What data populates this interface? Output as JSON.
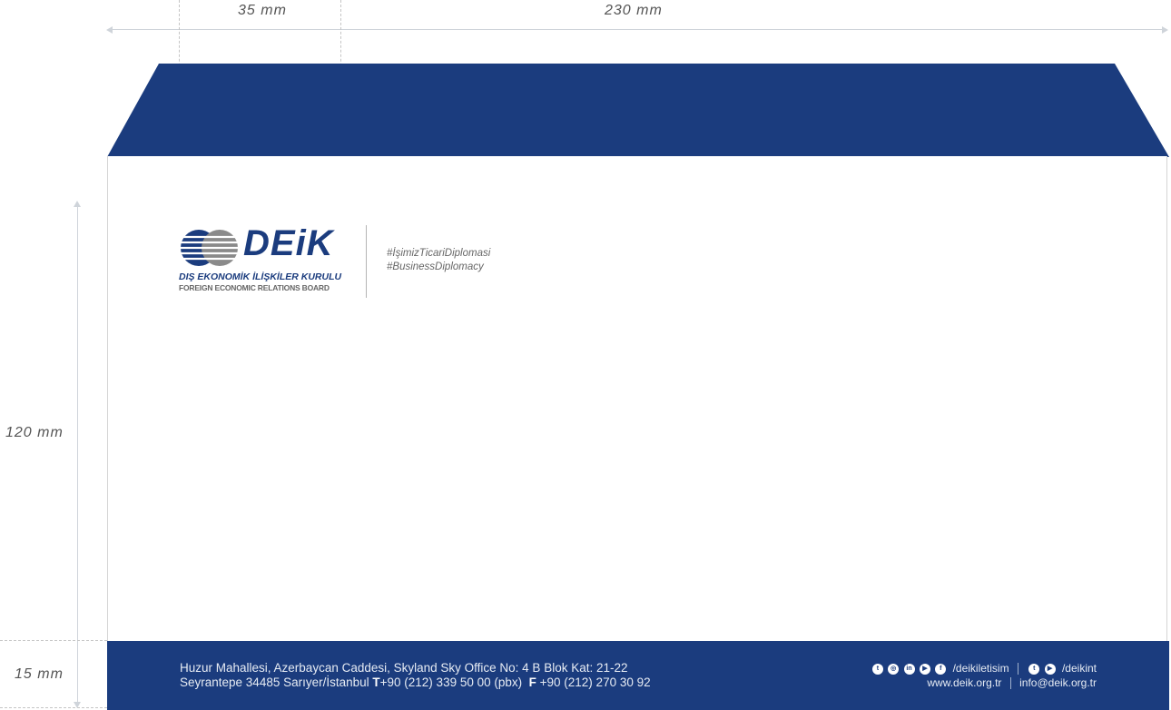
{
  "dimensions": {
    "logo_width": "35 mm",
    "envelope_width": "230 mm",
    "envelope_height": "120 mm",
    "footer_height": "15 mm"
  },
  "logo": {
    "wordmark": "DEiK",
    "subtitle_tr": "DIŞ EKONOMİK İLİŞKİLER KURULU",
    "subtitle_en": "FOREIGN ECONOMIC RELATIONS BOARD"
  },
  "hashtags": [
    "#İşimizTicariDiplomasi",
    "#BusinessDiplomacy"
  ],
  "footer": {
    "address_line1": "Huzur Mahallesi, Azerbaycan Caddesi, Skyland Sky Office No: 4 B Blok Kat: 21-22",
    "address_line2_pre": "Seyrantepe 34485 Sarıyer/İstanbul ",
    "phone_label": "T",
    "phone": "+90 (212) 339 50 00 (pbx)",
    "fax_label": "F",
    "fax": " +90 (212) 270 30 92",
    "social_handle_1": "/deikiletisim",
    "social_handle_2": "/deikint",
    "website": "www.deik.org.tr",
    "email": "info@deik.org.tr",
    "social_icons_1": [
      "twitter-icon",
      "instagram-icon",
      "linkedin-icon",
      "youtube-icon",
      "facebook-icon"
    ],
    "social_icons_2": [
      "twitter-icon",
      "youtube-icon"
    ]
  },
  "colors": {
    "brand_blue": "#1b3c7e",
    "logo_gray": "#8a8a8a"
  }
}
